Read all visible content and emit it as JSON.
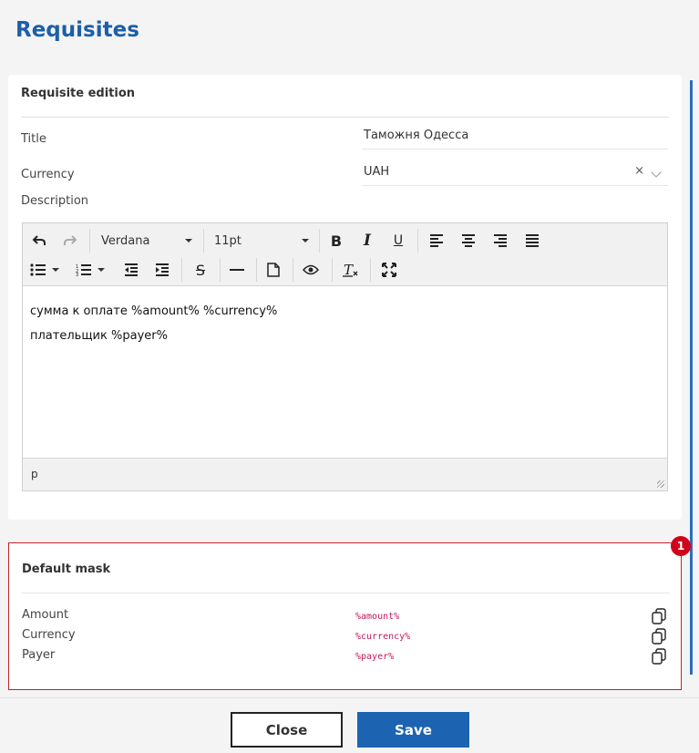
{
  "page": {
    "title": "Requisites"
  },
  "card": {
    "heading": "Requisite edition",
    "title_label": "Title",
    "title_value": "Таможня Одесса",
    "currency_label": "Currency",
    "currency_value": "UAH",
    "clear_glyph": "×",
    "description_label": "Description"
  },
  "editor": {
    "font_family": "Verdana",
    "font_size": "11pt",
    "lines": [
      "сумма к оплате %amount% %currency%",
      "плательщик %payer%"
    ],
    "statusbar_path": "p"
  },
  "mask": {
    "heading": "Default mask",
    "badge": "1",
    "rows": [
      {
        "label": "Amount",
        "code": "%amount%"
      },
      {
        "label": "Currency",
        "code": "%currency%"
      },
      {
        "label": "Payer",
        "code": "%payer%"
      }
    ]
  },
  "footer": {
    "close_label": "Close",
    "save_label": "Save"
  },
  "colors": {
    "accent": "#1c64b1",
    "title": "#1d5fa8",
    "highlight_border": "#c8202a",
    "badge": "#d0021b",
    "code": "#c2185b"
  }
}
